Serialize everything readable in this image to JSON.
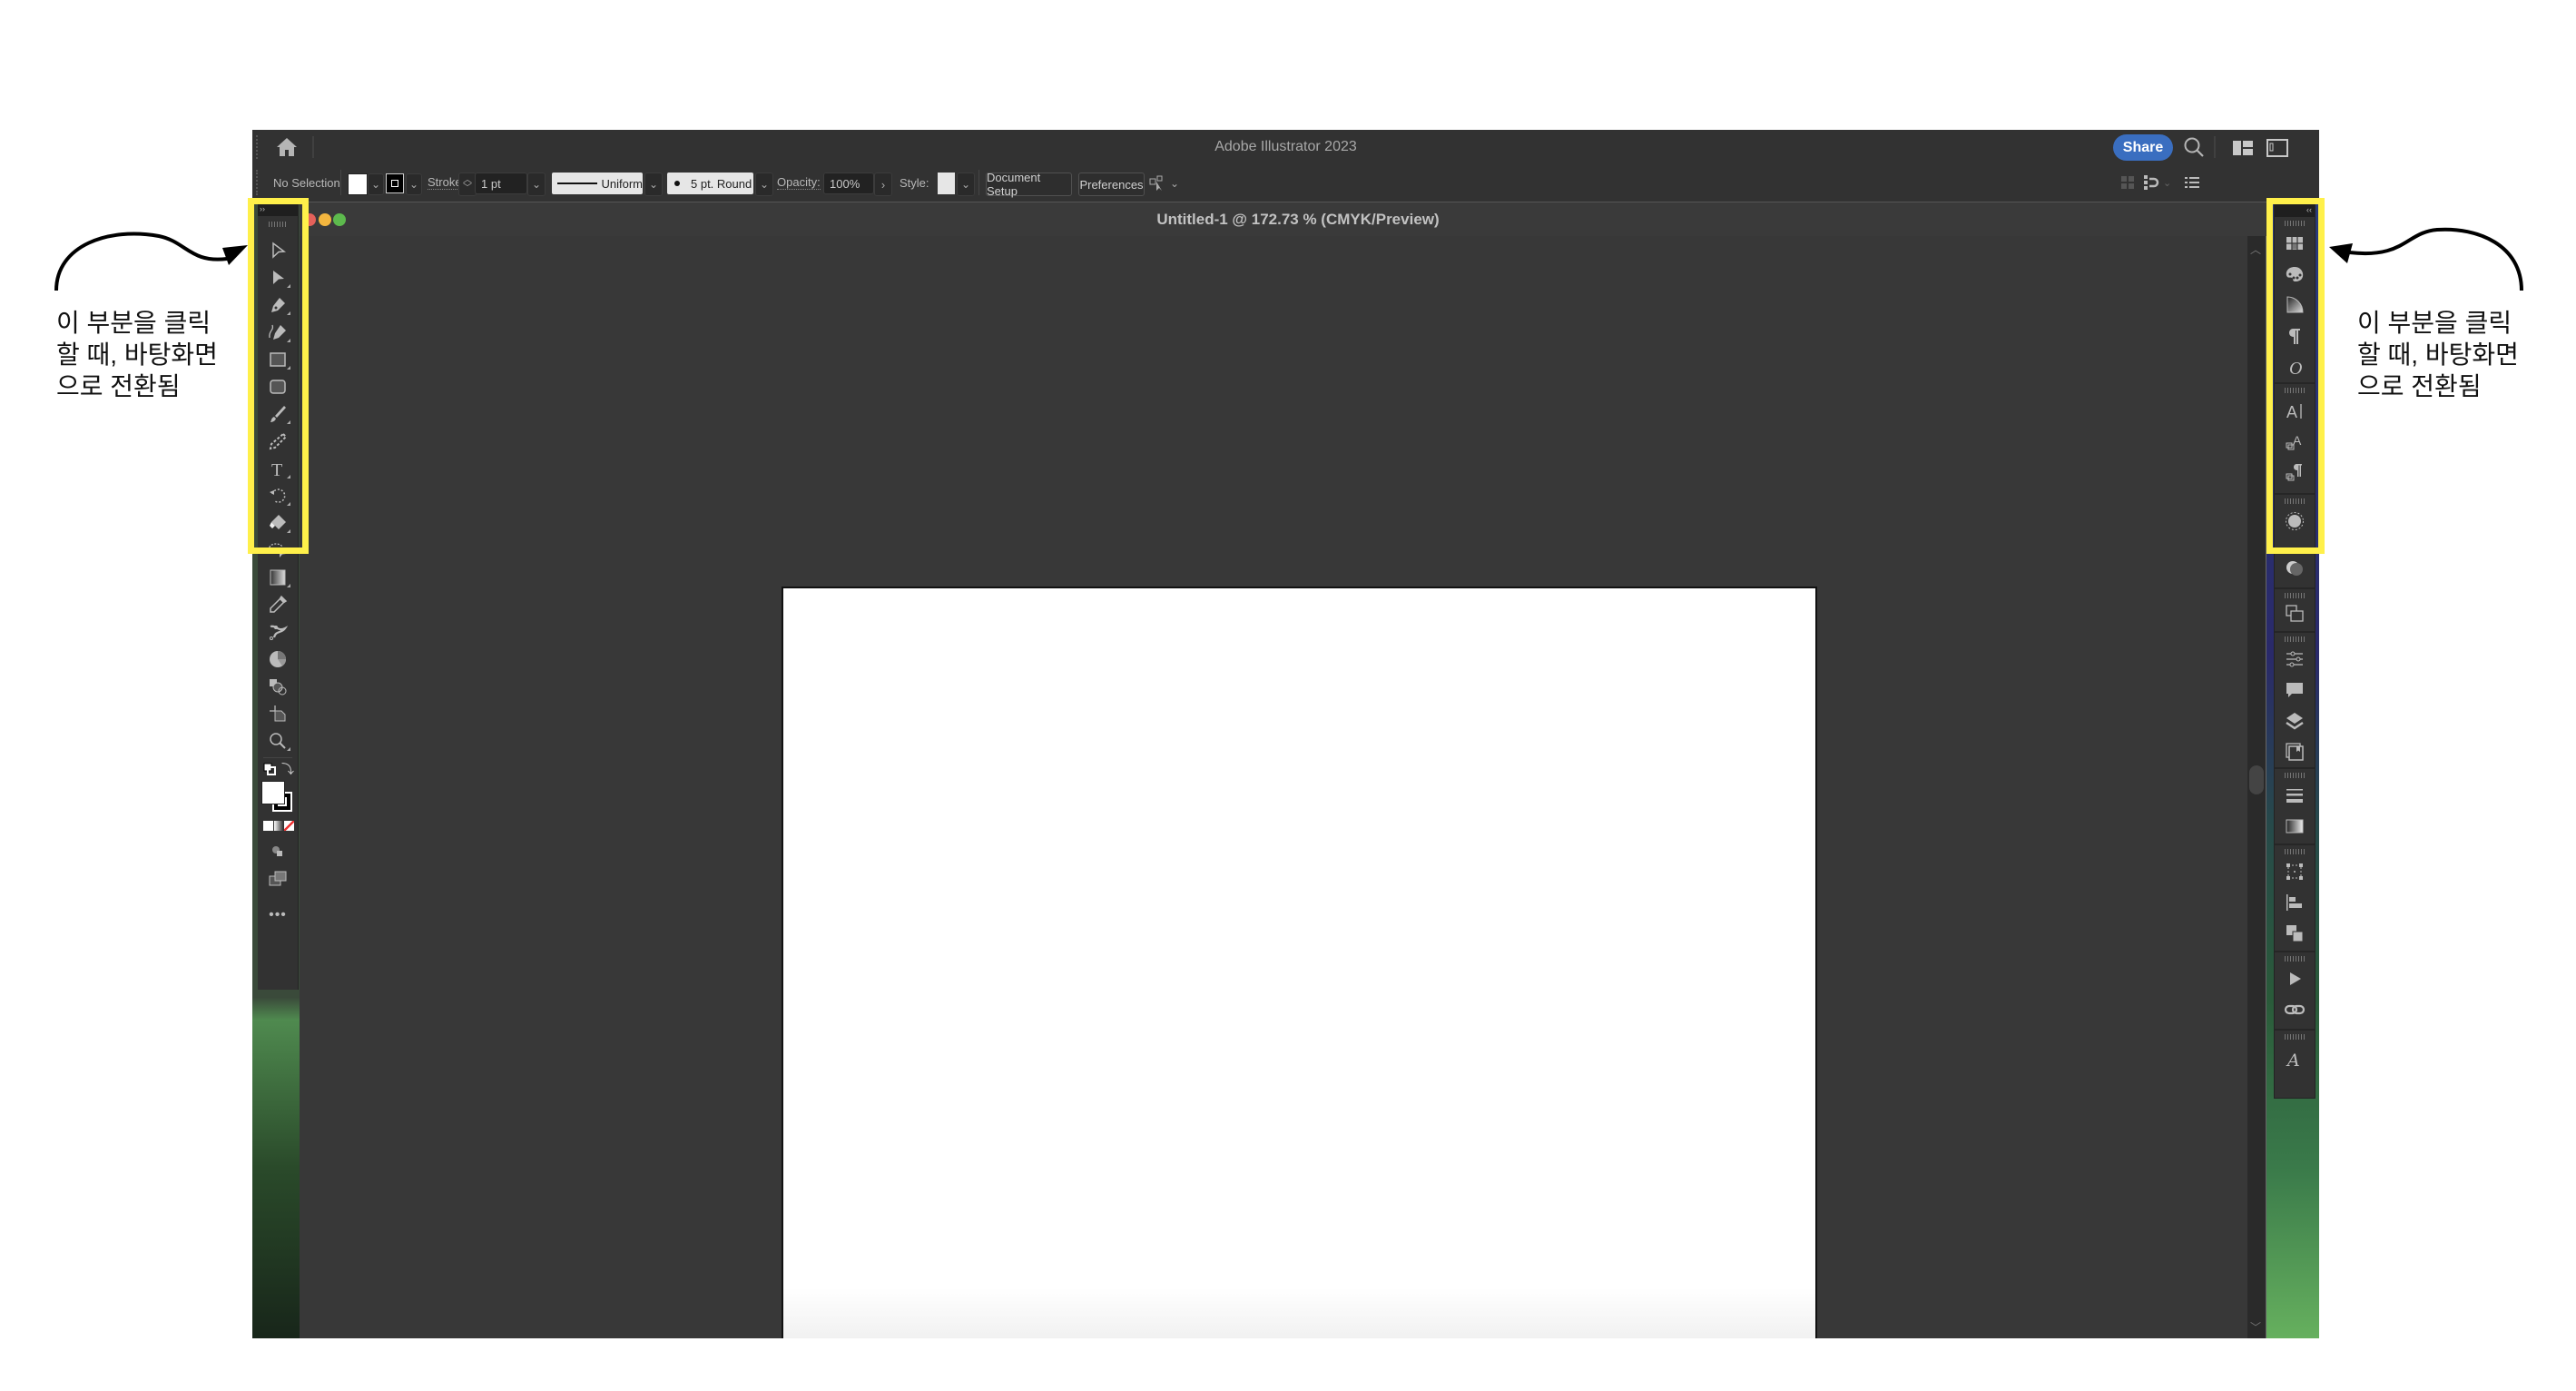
{
  "app": {
    "title": "Adobe Illustrator 2023",
    "share_label": "Share",
    "icons": [
      "home-icon",
      "search-icon",
      "arrange-documents-icon",
      "panel-layout-icon"
    ]
  },
  "control_bar": {
    "selection_label": "No Selection",
    "fill_color": "#ffffff",
    "stroke_label": "Stroke:",
    "stroke_weight": "1 pt",
    "stroke_profile": "Uniform",
    "brush": "5 pt. Round",
    "opacity_label": "Opacity:",
    "opacity_value": "100%",
    "style_label": "Style:",
    "document_setup_label": "Document Setup",
    "preferences_label": "Preferences",
    "right_icons": [
      "align-to-pixel-grid-icon",
      "snap-icon",
      "properties-menu-icon"
    ]
  },
  "document": {
    "tab_title": "Untitled-1 @ 172.73 % (CMYK/Preview)",
    "traffic_lights": {
      "close": "#e5615a",
      "minimize": "#f3b63f",
      "zoom": "#5dba4d"
    }
  },
  "left_toolbar": {
    "collapse_glyph": "››",
    "tools": [
      "selection-tool",
      "direct-selection-tool",
      "pen-tool",
      "curvature-tool",
      "rectangle-tool",
      "rounded-rectangle-tool",
      "paintbrush-tool",
      "blob-brush-tool",
      "type-tool",
      "rotate-tool",
      "eraser-tool",
      "lasso-tool",
      "gradient-tool",
      "eyedropper-tool",
      "puppet-warp-tool",
      "pie-graph-tool",
      "shape-builder-tool",
      "artboard-tool",
      "zoom-tool"
    ],
    "fill_color": "#ffffff",
    "stroke_color": "#000000",
    "more_label": "•••"
  },
  "right_panel": {
    "collapse_glyph": "‹‹",
    "groups": [
      [
        "swatches-icon",
        "color-guide-icon",
        "gradient-panel-icon",
        "paragraph-icon",
        "opentype-icon"
      ],
      [
        "character-icon",
        "character-styles-icon",
        "paragraph-styles-icon"
      ],
      [
        "appearance-icon"
      ],
      [
        "transparency-icon"
      ],
      [
        "pathfinder-icon"
      ],
      [
        "properties-icon",
        "comments-icon",
        "layers-icon",
        "libraries-icon"
      ],
      [
        "stroke-icon",
        "gradient-icon"
      ],
      [
        "transform-icon",
        "align-icon",
        "pathfinder-shapes-icon"
      ],
      [
        "actions-icon",
        "links-icon"
      ],
      [
        "glyphs-icon"
      ]
    ]
  },
  "annotations": {
    "left_text": "이 부분을 클릭\n할 때, 바탕화면\n으로 전환됨",
    "right_text": "이 부분을 클릭\n할 때, 바탕화면\n으로 전환됨",
    "highlight_color": "#fff04a"
  }
}
